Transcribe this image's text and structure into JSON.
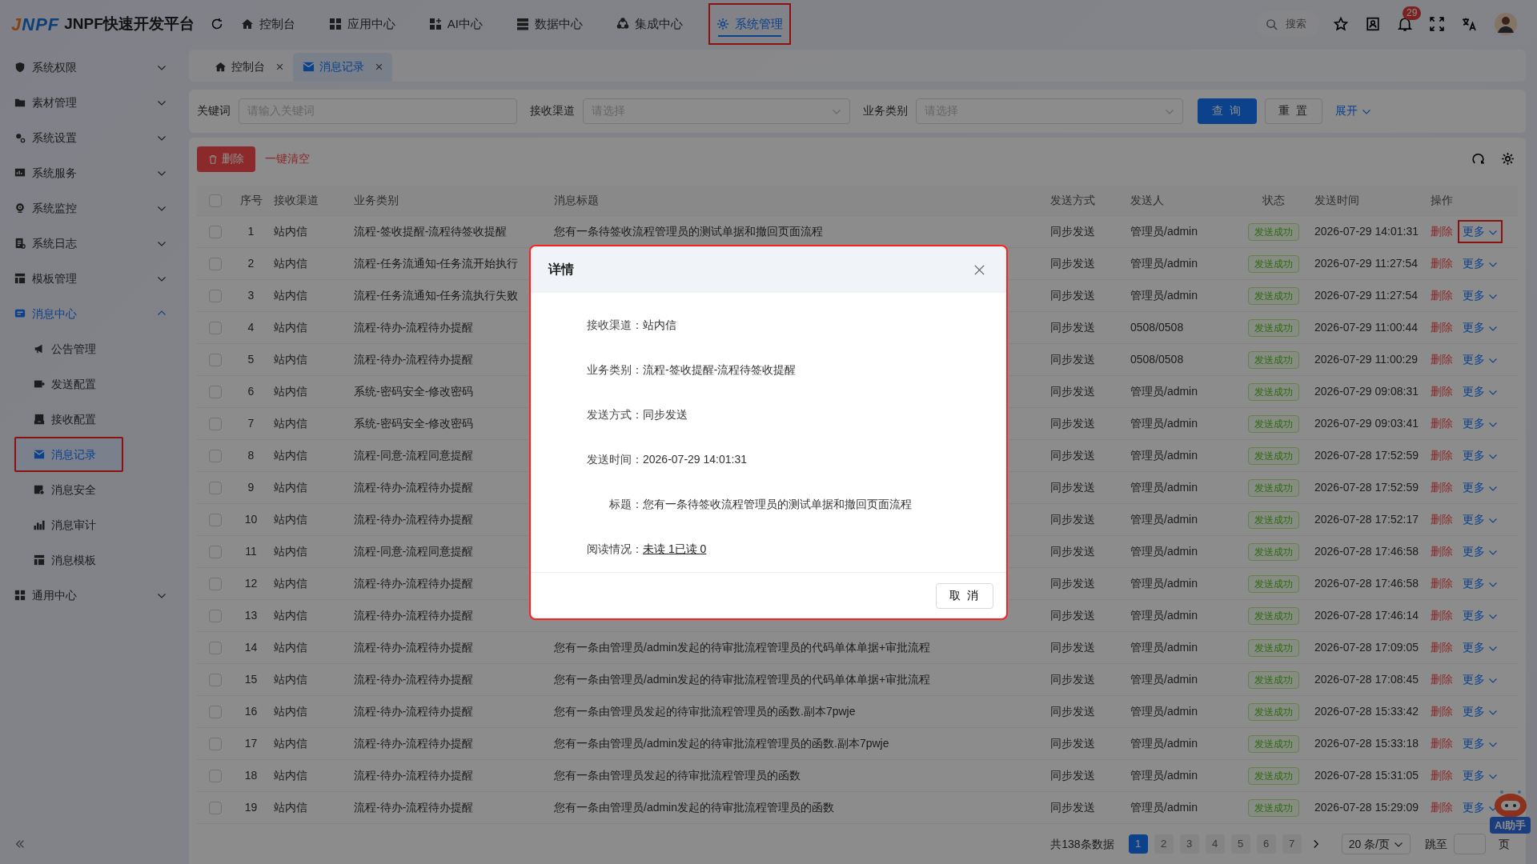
{
  "app": {
    "logo": "JNPF",
    "title": "JNPF快速开发平台"
  },
  "top_nav": [
    {
      "label": "控制台",
      "selected": false,
      "highlighted": false
    },
    {
      "label": "应用中心",
      "selected": false,
      "highlighted": false
    },
    {
      "label": "AI中心",
      "selected": false,
      "highlighted": false
    },
    {
      "label": "数据中心",
      "selected": false,
      "highlighted": false
    },
    {
      "label": "集成中心",
      "selected": false,
      "highlighted": false
    },
    {
      "label": "系统管理",
      "selected": true,
      "highlighted": true
    }
  ],
  "header_tools": {
    "search_placeholder": "搜索",
    "notification_count": "29"
  },
  "sidebar": {
    "items": [
      {
        "label": "系统权限",
        "expanded": false,
        "selected": false
      },
      {
        "label": "素材管理",
        "expanded": false,
        "selected": false
      },
      {
        "label": "系统设置",
        "expanded": false,
        "selected": false
      },
      {
        "label": "系统服务",
        "expanded": false,
        "selected": false
      },
      {
        "label": "系统监控",
        "expanded": false,
        "selected": false
      },
      {
        "label": "系统日志",
        "expanded": false,
        "selected": false
      },
      {
        "label": "模板管理",
        "expanded": false,
        "selected": false
      },
      {
        "label": "消息中心",
        "expanded": true,
        "selected": true,
        "children": [
          {
            "label": "公告管理",
            "selected": false,
            "highlighted": false
          },
          {
            "label": "发送配置",
            "selected": false,
            "highlighted": false
          },
          {
            "label": "接收配置",
            "selected": false,
            "highlighted": false
          },
          {
            "label": "消息记录",
            "selected": true,
            "highlighted": true
          },
          {
            "label": "消息安全",
            "selected": false,
            "highlighted": false
          },
          {
            "label": "消息审计",
            "selected": false,
            "highlighted": false
          },
          {
            "label": "消息模板",
            "selected": false,
            "highlighted": false
          }
        ]
      },
      {
        "label": "通用中心",
        "expanded": false,
        "selected": false
      }
    ]
  },
  "tabs": [
    {
      "label": "控制台",
      "selected": false
    },
    {
      "label": "消息记录",
      "selected": true
    }
  ],
  "filters": [
    {
      "kind": "text",
      "label": "关键词",
      "placeholder": "请输入关键词"
    },
    {
      "kind": "select",
      "label": "接收渠道",
      "placeholder": "请选择"
    },
    {
      "kind": "select",
      "label": "业务类别",
      "placeholder": "请选择"
    }
  ],
  "filter_buttons": {
    "search": "查 询",
    "reset": "重 置",
    "expand": "展开"
  },
  "toolbar": {
    "delete": "删除",
    "clear": "一键清空"
  },
  "table": {
    "all_checked": false,
    "columns": [
      "序号",
      "接收渠道",
      "业务类别",
      "消息标题",
      "发送方式",
      "发送人",
      "状态",
      "发送时间",
      "操作"
    ],
    "rows": [
      {
        "checked": false,
        "index": "1",
        "channel": "站内信",
        "category": "流程-签收提醒-流程待签收提醒",
        "title": "您有一条待签收流程管理员的测试单据和撤回页面流程",
        "method": "同步发送",
        "sender": "管理员/admin",
        "status": "发送成功",
        "time": "2026-07-29 14:01:31",
        "delete": "删除",
        "more": "更多",
        "more_highlighted": true
      },
      {
        "checked": false,
        "index": "2",
        "channel": "站内信",
        "category": "流程-任务流通知-任务流开始执行",
        "method": "同步发送",
        "sender": "管理员/admin",
        "status": "发送成功",
        "time": "2026-07-29 11:27:54",
        "delete": "删除",
        "more": "更多",
        "more_highlighted": false
      },
      {
        "checked": false,
        "index": "3",
        "channel": "站内信",
        "category": "流程-任务流通知-任务流执行失败",
        "method": "同步发送",
        "sender": "管理员/admin",
        "status": "发送成功",
        "time": "2026-07-29 11:27:54",
        "delete": "删除",
        "more": "更多",
        "more_highlighted": false
      },
      {
        "checked": false,
        "index": "4",
        "channel": "站内信",
        "category": "流程-待办-流程待办提醒",
        "method": "同步发送",
        "sender": "0508/0508",
        "status": "发送成功",
        "time": "2026-07-29 11:00:44",
        "delete": "删除",
        "more": "更多",
        "more_highlighted": false
      },
      {
        "checked": false,
        "index": "5",
        "channel": "站内信",
        "category": "流程-待办-流程待办提醒",
        "method": "同步发送",
        "sender": "0508/0508",
        "status": "发送成功",
        "time": "2026-07-29 11:00:29",
        "delete": "删除",
        "more": "更多",
        "more_highlighted": false
      },
      {
        "checked": false,
        "index": "6",
        "channel": "站内信",
        "category": "系统-密码安全-修改密码",
        "method": "同步发送",
        "sender": "管理员/admin",
        "status": "发送成功",
        "time": "2026-07-29 09:08:31",
        "delete": "删除",
        "more": "更多",
        "more_highlighted": false
      },
      {
        "checked": false,
        "index": "7",
        "channel": "站内信",
        "category": "系统-密码安全-修改密码",
        "method": "同步发送",
        "sender": "管理员/admin",
        "status": "发送成功",
        "time": "2026-07-29 09:03:41",
        "delete": "删除",
        "more": "更多",
        "more_highlighted": false
      },
      {
        "checked": false,
        "index": "8",
        "channel": "站内信",
        "category": "流程-同意-流程同意提醒",
        "method": "同步发送",
        "sender": "管理员/admin",
        "status": "发送成功",
        "time": "2026-07-28 17:52:59",
        "delete": "删除",
        "more": "更多",
        "more_highlighted": false
      },
      {
        "checked": false,
        "index": "9",
        "channel": "站内信",
        "category": "流程-待办-流程待办提醒",
        "method": "同步发送",
        "sender": "管理员/admin",
        "status": "发送成功",
        "time": "2026-07-28 17:52:59",
        "delete": "删除",
        "more": "更多",
        "more_highlighted": false
      },
      {
        "checked": false,
        "index": "10",
        "channel": "站内信",
        "category": "流程-待办-流程待办提醒",
        "method": "同步发送",
        "sender": "管理员/admin",
        "status": "发送成功",
        "time": "2026-07-28 17:52:17",
        "delete": "删除",
        "more": "更多",
        "more_highlighted": false
      },
      {
        "checked": false,
        "index": "11",
        "channel": "站内信",
        "category": "流程-同意-流程同意提醒",
        "method": "同步发送",
        "sender": "管理员/admin",
        "status": "发送成功",
        "time": "2026-07-28 17:46:58",
        "delete": "删除",
        "more": "更多",
        "more_highlighted": false
      },
      {
        "checked": false,
        "index": "12",
        "channel": "站内信",
        "category": "流程-待办-流程待办提醒",
        "method": "同步发送",
        "sender": "管理员/admin",
        "status": "发送成功",
        "time": "2026-07-28 17:46:58",
        "delete": "删除",
        "more": "更多",
        "more_highlighted": false
      },
      {
        "checked": false,
        "index": "13",
        "channel": "站内信",
        "category": "流程-待办-流程待办提醒",
        "method": "同步发送",
        "sender": "管理员/admin",
        "status": "发送成功",
        "time": "2026-07-28 17:46:14",
        "delete": "删除",
        "more": "更多",
        "more_highlighted": false
      },
      {
        "checked": false,
        "index": "14",
        "channel": "站内信",
        "category": "流程-待办-流程待办提醒",
        "title": "您有一条由管理员/admin发起的待审批流程管理员的代码单体单据+审批流程",
        "method": "同步发送",
        "sender": "管理员/admin",
        "status": "发送成功",
        "time": "2026-07-28 17:09:05",
        "delete": "删除",
        "more": "更多",
        "more_highlighted": false
      },
      {
        "checked": false,
        "index": "15",
        "channel": "站内信",
        "category": "流程-待办-流程待办提醒",
        "title": "您有一条由管理员/admin发起的待审批流程管理员的代码单体单据+审批流程",
        "method": "同步发送",
        "sender": "管理员/admin",
        "status": "发送成功",
        "time": "2026-07-28 17:08:45",
        "delete": "删除",
        "more": "更多",
        "more_highlighted": false
      },
      {
        "checked": false,
        "index": "16",
        "channel": "站内信",
        "category": "流程-待办-流程待办提醒",
        "title": "您有一条由管理员发起的待审批流程管理员的函数.副本7pwje",
        "method": "同步发送",
        "sender": "管理员/admin",
        "status": "发送成功",
        "time": "2026-07-28 15:33:42",
        "delete": "删除",
        "more": "更多",
        "more_highlighted": false
      },
      {
        "checked": false,
        "index": "17",
        "channel": "站内信",
        "category": "流程-待办-流程待办提醒",
        "title": "您有一条由管理员/admin发起的待审批流程管理员的函数.副本7pwje",
        "method": "同步发送",
        "sender": "管理员/admin",
        "status": "发送成功",
        "time": "2026-07-28 15:33:18",
        "delete": "删除",
        "more": "更多",
        "more_highlighted": false
      },
      {
        "checked": false,
        "index": "18",
        "channel": "站内信",
        "category": "流程-待办-流程待办提醒",
        "title": "您有一条由管理员发起的待审批流程管理员的函数",
        "method": "同步发送",
        "sender": "管理员/admin",
        "status": "发送成功",
        "time": "2026-07-28 15:31:05",
        "delete": "删除",
        "more": "更多",
        "more_highlighted": false
      },
      {
        "checked": false,
        "index": "19",
        "channel": "站内信",
        "category": "流程-待办-流程待办提醒",
        "title": "您有一条由管理员/admin发起的待审批流程管理员的函数",
        "method": "同步发送",
        "sender": "管理员/admin",
        "status": "发送成功",
        "time": "2026-07-28 15:29:09",
        "delete": "删除",
        "more": "更多",
        "more_highlighted": false
      }
    ]
  },
  "pagination": {
    "total": "共138条数据",
    "pages": [
      {
        "label": "1",
        "selected": true
      },
      {
        "label": "2",
        "selected": false
      },
      {
        "label": "3",
        "selected": false
      },
      {
        "label": "4",
        "selected": false
      },
      {
        "label": "5",
        "selected": false
      },
      {
        "label": "6",
        "selected": false
      },
      {
        "label": "7",
        "selected": false
      }
    ],
    "page_size": "20 条/页",
    "jump_label": "跳至",
    "page_suffix": "页"
  },
  "assistant": {
    "label": "AI助手"
  },
  "dialog": {
    "title": "详情",
    "highlighted": true,
    "fields": [
      {
        "kind": "text",
        "label": "接收渠道：",
        "value": "站内信"
      },
      {
        "kind": "text",
        "label": "业务类别：",
        "value": "流程-签收提醒-流程待签收提醒"
      },
      {
        "kind": "text",
        "label": "发送方式：",
        "value": "同步发送"
      },
      {
        "kind": "text",
        "label": "发送时间：",
        "value": "2026-07-29 14:01:31"
      },
      {
        "kind": "text",
        "label": "标题：",
        "value": "您有一条待签收流程管理员的测试单据和撤回页面流程"
      },
      {
        "kind": "link",
        "label": "阅读情况：",
        "value": "未读 1已读 0"
      }
    ],
    "cancel": "取 消"
  }
}
